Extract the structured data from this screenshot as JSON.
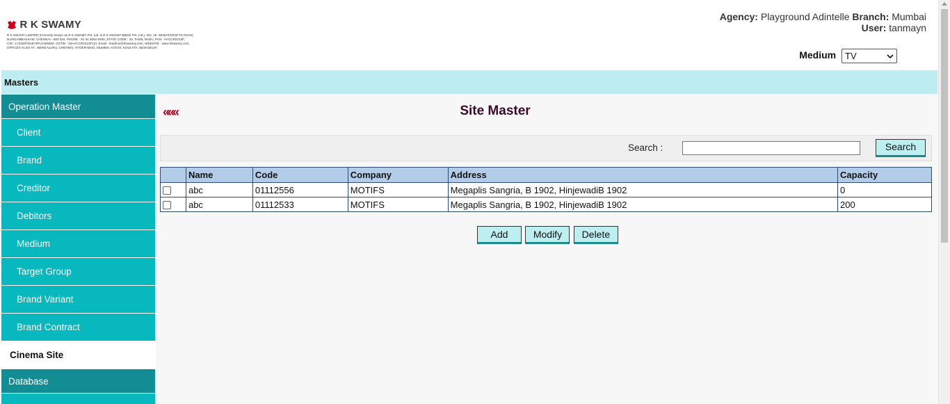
{
  "logo": {
    "title": "R K SWAMY",
    "fine_print": [
      "R K SWAMY LIMITED (Formerly known as R K SWAMY Pvt. Ltd. & R K SWAMY BBDO Pvt. Ltd.), NO. 19, WHEATCROFTS ROAD,",
      "NUNGAMBAKKAM, CHENNAI - 600 034. PHONE : 91 44 4654 8200, STATE CODE : 33, TAMIL NADU, PAN : AACCR2213F,",
      "CIN : L74300TN1973PLC006304, GSTIN : 33AACCR2213F1ZI, Email : rkadmin@rkswamy.com, WEBSITE : www.rkswamy.com,",
      "OFFICES ALSO AT : BENGALURU, CHENNAI, HYDERABAD, MUMBAI, KOCHI, KOLKATA, NEW DELHI"
    ]
  },
  "header": {
    "agency_label": "Agency:",
    "agency_value": "Playground Adintelle",
    "branch_label": "Branch:",
    "branch_value": "Mumbai",
    "user_label": "User:",
    "user_value": "tanmayn",
    "medium_label": "Medium",
    "medium_selected": "TV"
  },
  "masters_bar": {
    "label": "Masters"
  },
  "sidebar": {
    "section_header": "Operation Master",
    "items": [
      {
        "label": "Client"
      },
      {
        "label": "Brand"
      },
      {
        "label": "Creditor"
      },
      {
        "label": "Debitors"
      },
      {
        "label": "Medium"
      },
      {
        "label": "Target Group"
      },
      {
        "label": "Brand Variant"
      },
      {
        "label": "Brand Contract"
      }
    ],
    "active_item": "Cinema Site",
    "database_header": "Database"
  },
  "main": {
    "back_glyph": "«««",
    "title": "Site Master",
    "search_label": "Search :",
    "search_value": "",
    "search_button": "Search",
    "table": {
      "columns": [
        "",
        "Name",
        "Code",
        "Company",
        "Address",
        "Capacity"
      ],
      "rows": [
        {
          "name": "abc",
          "code": "01112556",
          "company": "MOTIFS",
          "address": "Megaplis Sangria, B 1902, HinjewadiB 1902",
          "capacity": "0"
        },
        {
          "name": "abc",
          "code": "01112533",
          "company": "MOTIFS",
          "address": "Megaplis Sangria, B 1902, HinjewadiB 1902",
          "capacity": "200"
        }
      ]
    },
    "buttons": {
      "add": "Add",
      "modify": "Modify",
      "delete": "Delete"
    }
  },
  "colors": {
    "sidebar_dark": "#138d94",
    "sidebar_item": "#07b8bf",
    "masters_bar": "#bdedf0",
    "title": "#3b0a2a",
    "back_arrows": "#b0001a",
    "table_header": "#b3cde8"
  }
}
